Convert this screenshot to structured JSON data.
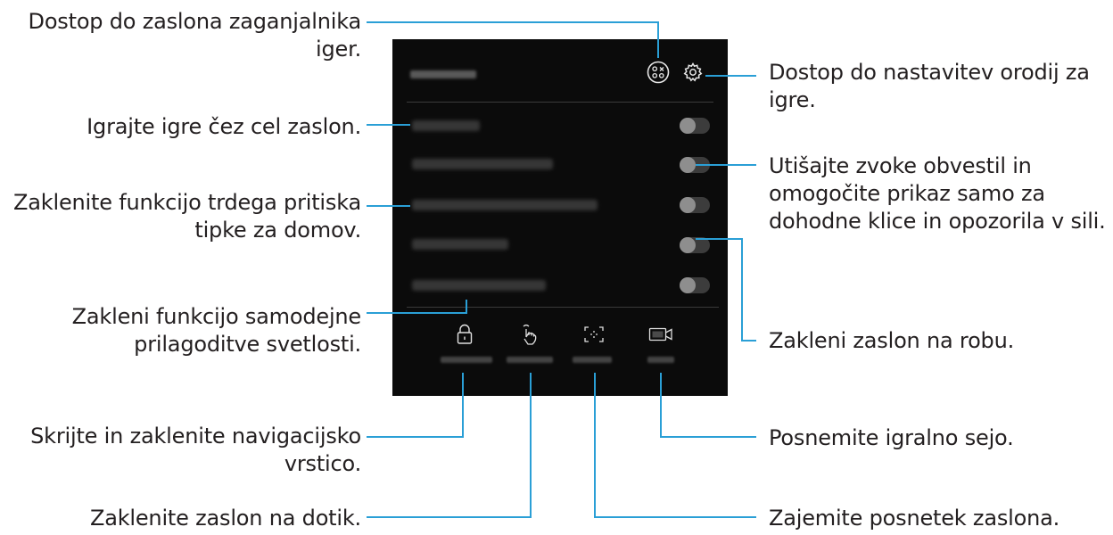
{
  "callouts": {
    "game_launcher": [
      "Dostop do zaslona zaganjalnika",
      "iger."
    ],
    "full_screen": [
      "Igrajte igre čez cel zaslon."
    ],
    "home_button_lock": [
      "Zaklenite funkcijo trdega pritiska",
      "tipke za domov."
    ],
    "brightness_lock": [
      "Zakleni funkcijo samodejne",
      "prilagoditve svetlosti."
    ],
    "navigation_lock": [
      "Skrijte in zaklenite navigacijsko",
      "vrstico."
    ],
    "touch_lock": [
      "Zaklenite zaslon na dotik."
    ],
    "settings": [
      "Dostop do nastavitev orodij za",
      "igre."
    ],
    "no_alerts": [
      "Utišajte zvoke obvestil in",
      "omogočite prikaz samo za",
      "dohodne klice in opozorila v sili."
    ],
    "edge_lock": [
      "Zakleni zaslon na robu."
    ],
    "record": [
      "Posnemite igralno sejo."
    ],
    "screenshot": [
      "Zajemite posnetek zaslona."
    ]
  },
  "panel": {
    "header_label": "",
    "rows": [
      {
        "label": "",
        "state": "off"
      },
      {
        "label": "",
        "state": "off"
      },
      {
        "label": "",
        "state": "off"
      },
      {
        "label": "",
        "state": "off"
      },
      {
        "label": "",
        "state": "off"
      }
    ],
    "tools": [
      {
        "icon": "lock-icon",
        "label": ""
      },
      {
        "icon": "touch-hand-icon",
        "label": ""
      },
      {
        "icon": "screenshot-frame-icon",
        "label": ""
      },
      {
        "icon": "video-camera-icon",
        "label": ""
      }
    ],
    "header_icons": [
      "game-launcher-icon",
      "gear-icon"
    ]
  },
  "colors": {
    "connector": "#2a9fd6",
    "panel_background": "#0b0b0b",
    "text": "#231f20"
  }
}
